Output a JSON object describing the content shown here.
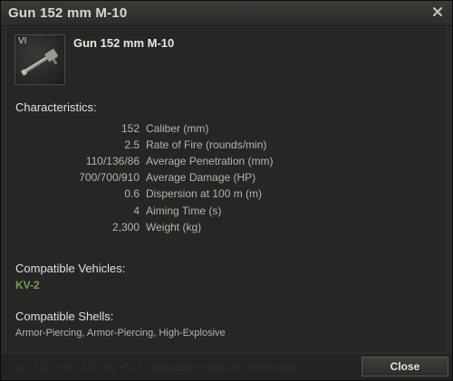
{
  "window": {
    "title": "Gun 152 mm M-10",
    "footer_ghost_text": "Gun 152 mm M-10 for KV-2 compatible modules information",
    "close_button_label": "Close"
  },
  "module": {
    "tier": "VI",
    "name": "Gun 152 mm M-10"
  },
  "characteristics": {
    "header": "Characteristics:",
    "rows": [
      {
        "value": "152",
        "label": "Caliber (mm)"
      },
      {
        "value": "2.5",
        "label": "Rate of Fire (rounds/min)"
      },
      {
        "value": "110/136/86",
        "label": "Average Penetration (mm)"
      },
      {
        "value": "700/700/910",
        "label": "Average Damage (HP)"
      },
      {
        "value": "0.6",
        "label": "Dispersion at 100 m (m)"
      },
      {
        "value": "4",
        "label": "Aiming Time (s)"
      },
      {
        "value": "2,300",
        "label": "Weight (kg)"
      }
    ]
  },
  "compatible_vehicles": {
    "header": "Compatible Vehicles:",
    "vehicle": "KV-2",
    "vehicle_color": "#6fa552"
  },
  "compatible_shells": {
    "header": "Compatible Shells:",
    "text": "Armor-Piercing, Armor-Piercing, High-Explosive"
  },
  "icons": {
    "close": "close-icon",
    "module": "gun-icon"
  }
}
